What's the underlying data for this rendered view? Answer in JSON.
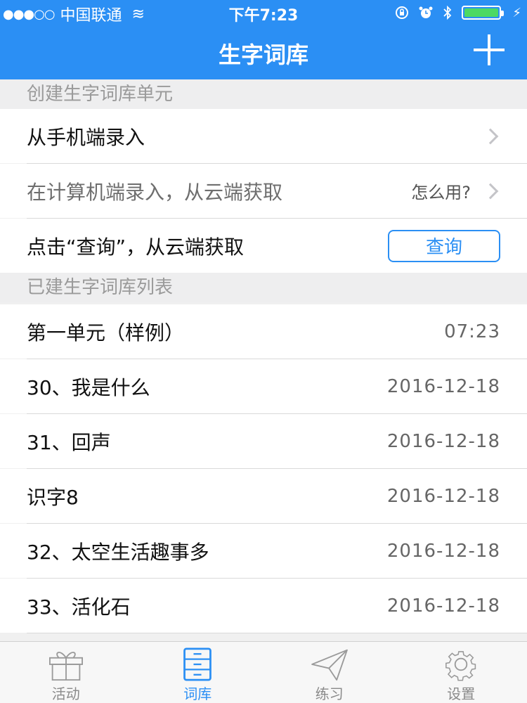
{
  "status_bar": {
    "signal": "●●●○○",
    "carrier": "中国联通",
    "wifi": "≋",
    "time": "下午7:23",
    "icons": [
      "lock-rotation-icon",
      "alarm-icon",
      "bluetooth-icon"
    ],
    "battery_level": 1.0,
    "charging": "⚡"
  },
  "nav": {
    "title": "生字词库",
    "add_icon": "plus-icon"
  },
  "section_create": {
    "header": "创建生字词库单元",
    "rows": [
      {
        "label": "从手机端录入"
      },
      {
        "label": "在计算机端录入，从云端获取",
        "meta": "怎么用?"
      },
      {
        "label": "点击“查询”，从云端获取",
        "button": "查询"
      }
    ]
  },
  "section_list": {
    "header": "已建生字词库列表",
    "items": [
      {
        "name": "第一单元（样例）",
        "date": "07:23"
      },
      {
        "name": "30、我是什么",
        "date": "2016-12-18"
      },
      {
        "name": "31、回声",
        "date": "2016-12-18"
      },
      {
        "name": "识字8",
        "date": "2016-12-18"
      },
      {
        "name": "32、太空生活趣事多",
        "date": "2016-12-18"
      },
      {
        "name": "33、活化石",
        "date": "2016-12-18"
      }
    ]
  },
  "tabbar": {
    "tabs": [
      {
        "label": "活动",
        "icon": "gift-icon"
      },
      {
        "label": "词库",
        "icon": "cabinet-icon",
        "active": true
      },
      {
        "label": "练习",
        "icon": "paper-plane-icon"
      },
      {
        "label": "设置",
        "icon": "gear-icon"
      }
    ]
  },
  "colors": {
    "accent": "#2b8ff4",
    "background": "#f0f0f0"
  }
}
